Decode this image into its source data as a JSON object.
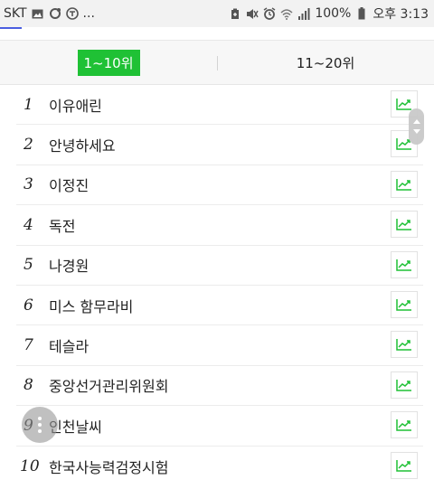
{
  "status_bar": {
    "carrier": "SKT",
    "more": "...",
    "battery": "100%",
    "time": "오후 3:13",
    "left_icons": [
      "image-icon",
      "sync-icon",
      "toon-icon"
    ],
    "right_icons": [
      "battery-saver-icon",
      "mute-icon",
      "alarm-icon",
      "wifi-icon",
      "signal-icon",
      "battery-icon"
    ]
  },
  "tabs": [
    {
      "label": "1~10위",
      "active": true
    },
    {
      "label": "11~20위",
      "active": false
    }
  ],
  "rankings": [
    {
      "rank": "1",
      "keyword": "이유애린"
    },
    {
      "rank": "2",
      "keyword": "안녕하세요"
    },
    {
      "rank": "3",
      "keyword": "이정진"
    },
    {
      "rank": "4",
      "keyword": "독전"
    },
    {
      "rank": "5",
      "keyword": "나경원"
    },
    {
      "rank": "6",
      "keyword": "미스 함무라비"
    },
    {
      "rank": "7",
      "keyword": "테슬라"
    },
    {
      "rank": "8",
      "keyword": "중앙선거관리위원회"
    },
    {
      "rank": "9",
      "keyword": "인천날씨"
    },
    {
      "rank": "10",
      "keyword": "한국사능력검정시험"
    }
  ],
  "colors": {
    "accent": "#1fc135",
    "trend_icon": "#1fc135"
  }
}
